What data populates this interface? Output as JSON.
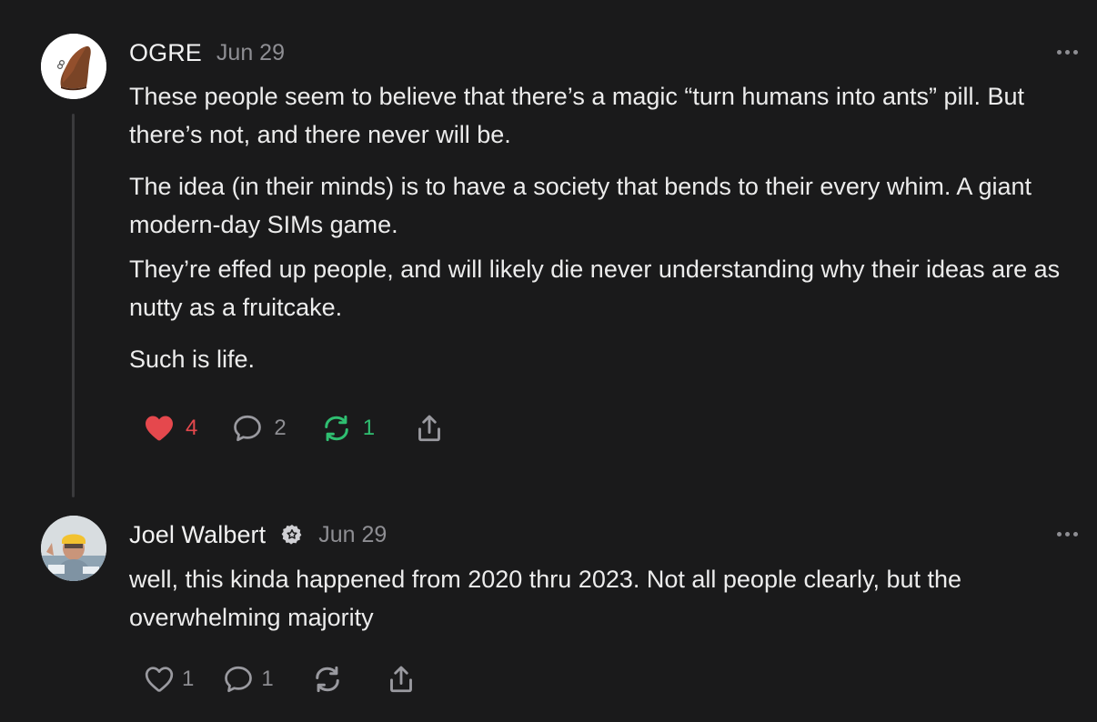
{
  "comments": [
    {
      "author": "OGRE",
      "date": "Jun 29",
      "paragraphs": [
        "These people seem to believe that there’s a magic “turn humans into ants” pill. But there’s not, and there never will be.",
        "The idea (in their minds) is to have a society that bends to their every whim. A giant modern-day SIMs game.",
        "They’re effed up people, and will likely die never understanding why their ideas are as nutty as a fruitcake.",
        "Such is life."
      ],
      "likes": "4",
      "replies": "2",
      "restacks": "1",
      "liked": true,
      "restacked": true
    },
    {
      "author": "Joel Walbert",
      "date": "Jun 29",
      "paragraphs": [
        "well, this kinda happened from 2020 thru 2023. Not all people clearly, but the overwhelming majority"
      ],
      "likes": "1",
      "replies": "1",
      "restacks": "",
      "liked": false,
      "restacked": false
    }
  ],
  "colors": {
    "background": "#1a1a1b",
    "like_active": "#e5484d",
    "restack_active": "#2fbf71",
    "muted": "#8e8e93"
  },
  "icons": [
    "heart-icon",
    "comment-icon",
    "restack-icon",
    "share-icon",
    "more-icon",
    "verified-badge-icon"
  ]
}
